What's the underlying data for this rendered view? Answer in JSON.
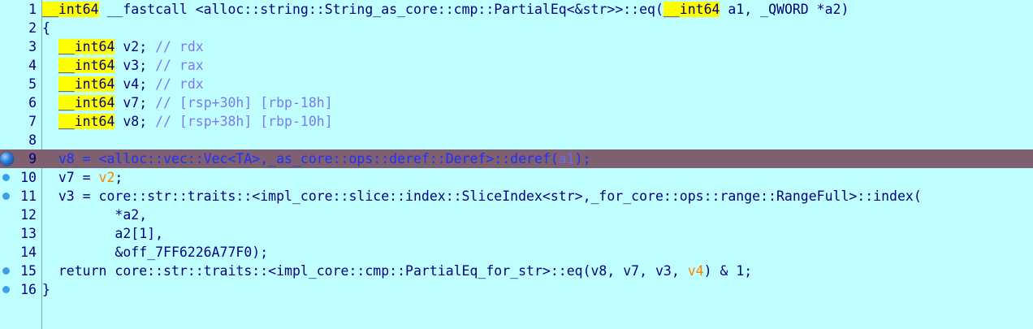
{
  "lines": [
    {
      "n": "1",
      "parts": [
        {
          "t": "__int64",
          "c": "hl"
        },
        {
          "t": " __fastcall <alloc::string::String_as_core::cmp::PartialEq<&str>>::eq(",
          "c": "kw"
        },
        {
          "t": "__int64",
          "c": "hl"
        },
        {
          "t": " a1, _QWORD *a2)",
          "c": "kw"
        }
      ]
    },
    {
      "n": "2",
      "parts": [
        {
          "t": "{",
          "c": "kw"
        }
      ]
    },
    {
      "n": "3",
      "parts": [
        {
          "t": "  ",
          "c": "kw"
        },
        {
          "t": "__int64",
          "c": "hl"
        },
        {
          "t": " v2; ",
          "c": "kw"
        },
        {
          "t": "// rdx",
          "c": "cm"
        }
      ]
    },
    {
      "n": "4",
      "parts": [
        {
          "t": "  ",
          "c": "kw"
        },
        {
          "t": "__int64",
          "c": "hl"
        },
        {
          "t": " v3; ",
          "c": "kw"
        },
        {
          "t": "// rax",
          "c": "cm"
        }
      ]
    },
    {
      "n": "5",
      "parts": [
        {
          "t": "  ",
          "c": "kw"
        },
        {
          "t": "__int64",
          "c": "hl"
        },
        {
          "t": " v4; ",
          "c": "kw"
        },
        {
          "t": "// rdx",
          "c": "cm"
        }
      ]
    },
    {
      "n": "6",
      "parts": [
        {
          "t": "  ",
          "c": "kw"
        },
        {
          "t": "__int64",
          "c": "hl"
        },
        {
          "t": " v7; ",
          "c": "kw"
        },
        {
          "t": "// [rsp+30h] [rbp-18h]",
          "c": "cm"
        }
      ]
    },
    {
      "n": "7",
      "parts": [
        {
          "t": "  ",
          "c": "kw"
        },
        {
          "t": "__int64",
          "c": "hl"
        },
        {
          "t": " v8; ",
          "c": "kw"
        },
        {
          "t": "// [rsp+38h] [rbp-10h]",
          "c": "cm"
        }
      ]
    },
    {
      "n": "8",
      "parts": []
    },
    {
      "n": "9",
      "current": true,
      "bp": "big",
      "parts": [
        {
          "t": "  v8 = <alloc::vec::Vec<TA>,_as_core::ops::deref::Deref>::deref(",
          "c": "cur-text"
        },
        {
          "t": "a1",
          "c": "cur-arg"
        },
        {
          "t": ");",
          "c": "cur-text"
        }
      ]
    },
    {
      "n": "10",
      "bp": "small",
      "parts": [
        {
          "t": "  v7 = ",
          "c": "kw"
        },
        {
          "t": "v2",
          "c": "orange"
        },
        {
          "t": ";",
          "c": "kw"
        }
      ]
    },
    {
      "n": "11",
      "bp": "small",
      "parts": [
        {
          "t": "  v3 = core::str::traits::<impl_core::slice::index::SliceIndex<str>,_for_core::ops::range::RangeFull>::index(",
          "c": "kw"
        }
      ]
    },
    {
      "n": "12",
      "parts": [
        {
          "t": "         *a2,",
          "c": "kw"
        }
      ]
    },
    {
      "n": "13",
      "parts": [
        {
          "t": "         a2[1],",
          "c": "kw"
        }
      ]
    },
    {
      "n": "14",
      "parts": [
        {
          "t": "         &off_7FF6226A77F0);",
          "c": "kw"
        }
      ]
    },
    {
      "n": "15",
      "bp": "small",
      "parts": [
        {
          "t": "  return core::str::traits::<impl_core::cmp::PartialEq_for_str>::eq(v8, v7, v3, ",
          "c": "kw"
        },
        {
          "t": "v4",
          "c": "orange"
        },
        {
          "t": ") & 1;",
          "c": "kw"
        }
      ]
    },
    {
      "n": "16",
      "bp": "small",
      "parts": [
        {
          "t": "}",
          "c": "kw"
        }
      ]
    }
  ]
}
